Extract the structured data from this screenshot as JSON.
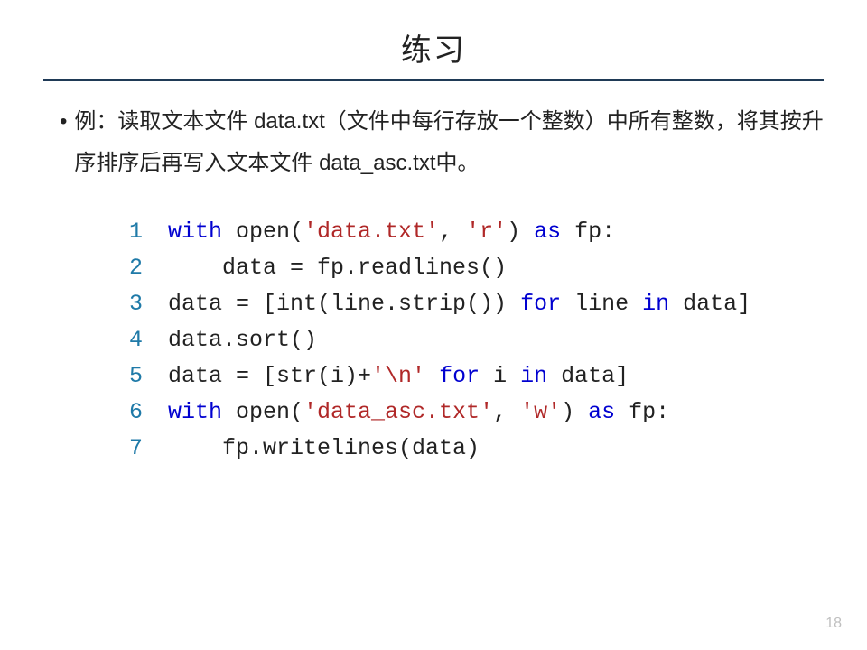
{
  "title": "练习",
  "bullet": "例：读取文本文件 data.txt（文件中每行存放一个整数）中所有整数，将其按升序排序后再写入文本文件 data_asc.txt中。",
  "code": {
    "lines": [
      {
        "n": "1",
        "segments": [
          {
            "cls": "kw",
            "t": "with"
          },
          {
            "cls": "pl",
            "t": " open("
          },
          {
            "cls": "str",
            "t": "'data.txt'"
          },
          {
            "cls": "pl",
            "t": ", "
          },
          {
            "cls": "str",
            "t": "'r'"
          },
          {
            "cls": "pl",
            "t": ") "
          },
          {
            "cls": "kw",
            "t": "as"
          },
          {
            "cls": "pl",
            "t": " fp:"
          }
        ]
      },
      {
        "n": "2",
        "segments": [
          {
            "cls": "guide",
            "t": "    "
          },
          {
            "cls": "pl",
            "t": "data = fp.readlines()"
          }
        ]
      },
      {
        "n": "3",
        "segments": [
          {
            "cls": "pl",
            "t": "data = [int(line.strip()) "
          },
          {
            "cls": "kw",
            "t": "for"
          },
          {
            "cls": "pl",
            "t": " line "
          },
          {
            "cls": "kw",
            "t": "in"
          },
          {
            "cls": "pl",
            "t": " data]"
          }
        ]
      },
      {
        "n": "4",
        "segments": [
          {
            "cls": "pl",
            "t": "data.sort()"
          }
        ]
      },
      {
        "n": "5",
        "segments": [
          {
            "cls": "pl",
            "t": "data = [str(i)+"
          },
          {
            "cls": "str",
            "t": "'\\n'"
          },
          {
            "cls": "pl",
            "t": " "
          },
          {
            "cls": "kw",
            "t": "for"
          },
          {
            "cls": "pl",
            "t": " i "
          },
          {
            "cls": "kw",
            "t": "in"
          },
          {
            "cls": "pl",
            "t": " data]"
          }
        ]
      },
      {
        "n": "6",
        "segments": [
          {
            "cls": "kw",
            "t": "with"
          },
          {
            "cls": "pl",
            "t": " open("
          },
          {
            "cls": "str",
            "t": "'data_asc.txt'"
          },
          {
            "cls": "pl",
            "t": ", "
          },
          {
            "cls": "str",
            "t": "'w'"
          },
          {
            "cls": "pl",
            "t": ") "
          },
          {
            "cls": "kw",
            "t": "as"
          },
          {
            "cls": "pl",
            "t": " fp:"
          }
        ]
      },
      {
        "n": "7",
        "segments": [
          {
            "cls": "guide",
            "t": "    "
          },
          {
            "cls": "pl",
            "t": "fp.writelines(data)"
          }
        ]
      }
    ]
  },
  "page_number": "18"
}
